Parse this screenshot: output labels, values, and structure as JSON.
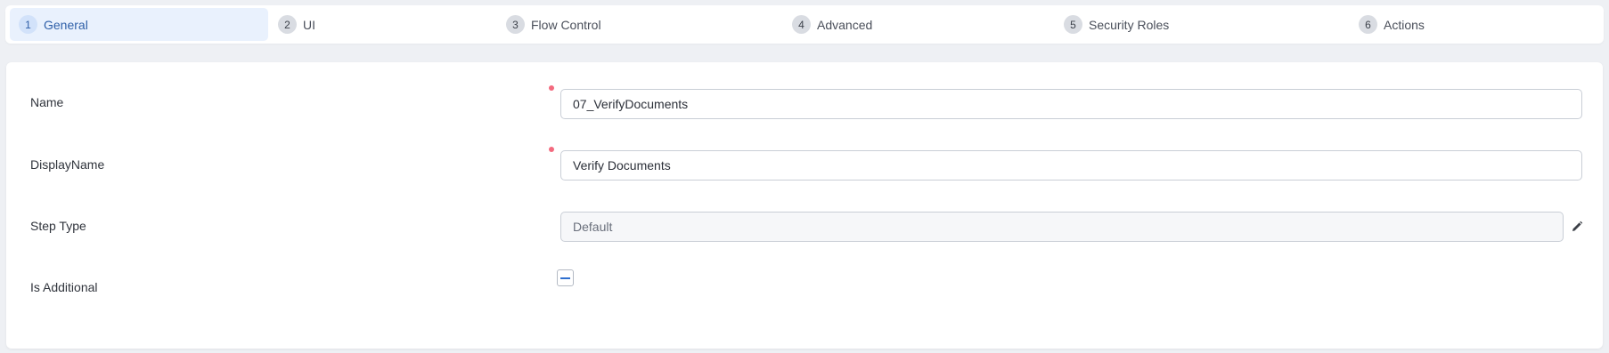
{
  "tabs": [
    {
      "num": "1",
      "label": "General",
      "active": true
    },
    {
      "num": "2",
      "label": "UI"
    },
    {
      "num": "3",
      "label": "Flow Control"
    },
    {
      "num": "4",
      "label": "Advanced"
    },
    {
      "num": "5",
      "label": "Security Roles"
    },
    {
      "num": "6",
      "label": "Actions"
    }
  ],
  "form": {
    "name": {
      "label": "Name",
      "value": "07_VerifyDocuments",
      "required": true
    },
    "display_name": {
      "label": "DisplayName",
      "value": "Verify Documents",
      "required": true
    },
    "step_type": {
      "label": "Step Type",
      "value": "Default",
      "edit_icon": "pencil-icon"
    },
    "is_additional": {
      "label": "Is Additional",
      "state": "indeterminate"
    }
  },
  "colors": {
    "accent": "#2e5fa8",
    "active_tab_bg": "#e9f1fd",
    "required_dot": "#f36a7e",
    "checkbox_mark": "#2f6fcf"
  }
}
